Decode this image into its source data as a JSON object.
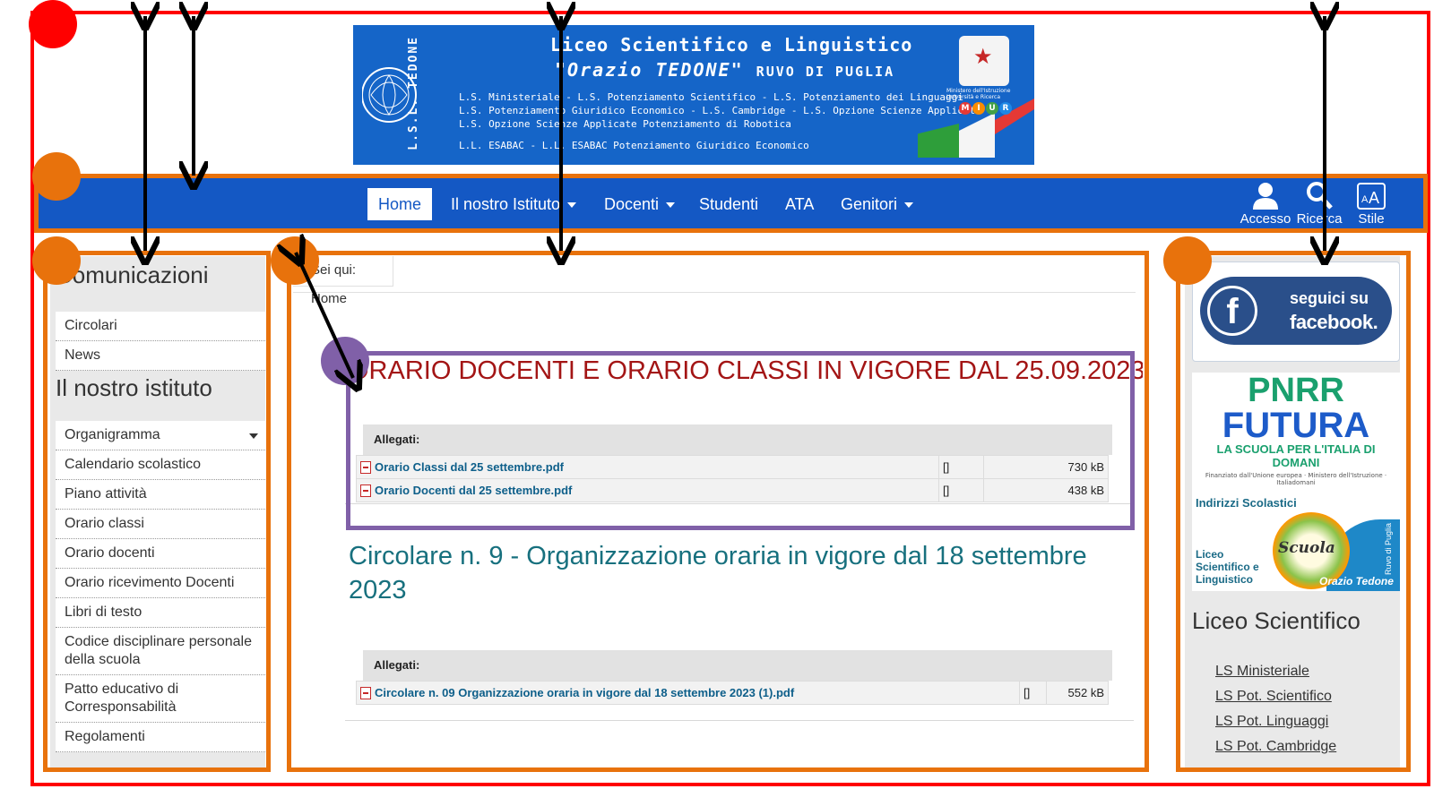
{
  "banner": {
    "seal_text": "L.S.L. TEDONE",
    "line1": "Liceo Scientifico e Linguistico",
    "line2": "\"Orazio TEDONE\"",
    "line2_tail": "RUVO DI PUGLIA",
    "small_lines": [
      "L.S. Ministeriale - L.S. Potenziamento Scientifico - L.S. Potenziamento dei Linguaggi",
      "L.S. Potenziamento Giuridico Economico - L.S. Cambridge - L.S. Opzione Scienze Applicate",
      "L.S. Opzione Scienze Applicate Potenziamento di Robotica",
      "L.L. ESABAC - L.L. ESABAC Potenziamento Giuridico Economico"
    ],
    "ministry": "Ministero dell'Istruzione Università e Ricerca",
    "miur_letters": [
      "M",
      "I",
      "U",
      "R"
    ],
    "miur_colors": [
      "#e53935",
      "#fb8c00",
      "#43a047",
      "#1e88e5"
    ]
  },
  "nav": {
    "items": [
      {
        "label": "Home",
        "active": true,
        "dropdown": false
      },
      {
        "label": "Il nostro Istituto",
        "active": false,
        "dropdown": true
      },
      {
        "label": "Docenti",
        "active": false,
        "dropdown": true
      },
      {
        "label": "Studenti",
        "active": false,
        "dropdown": false
      },
      {
        "label": "ATA",
        "active": false,
        "dropdown": false
      },
      {
        "label": "Genitori",
        "active": false,
        "dropdown": true
      }
    ],
    "utilities": [
      {
        "label": "Accesso",
        "icon": "user-icon"
      },
      {
        "label": "Ricerca",
        "icon": "search-icon"
      },
      {
        "label": "Stile",
        "icon": "text-size-icon"
      }
    ]
  },
  "left_sidebar": {
    "section1_title": "Comunicazioni",
    "section1_items": [
      "Circolari",
      "News"
    ],
    "section2_title": "Il nostro istituto",
    "section2_items": [
      "Organigramma",
      "Calendario scolastico",
      "Piano attività",
      "Orario classi",
      "Orario docenti",
      "Orario ricevimento Docenti",
      "Libri di testo",
      "Codice disciplinare personale della scuola",
      "Patto educativo di Corresponsabilità",
      "Regolamenti"
    ]
  },
  "main": {
    "breadcrumb": "Sei qui:  Home",
    "article1": {
      "title": "ORARIO DOCENTI E ORARIO CLASSI IN VIGORE DAL 25.09.2023",
      "attachments_label": "Allegati:",
      "files": [
        {
          "name": "Orario Classi dal 25 settembre.pdf",
          "hits": "[]",
          "size": "730 kB"
        },
        {
          "name": "Orario Docenti dal 25 settembre.pdf",
          "hits": "[]",
          "size": "438 kB"
        }
      ]
    },
    "article2": {
      "title": "Circolare n. 9 - Organizzazione oraria in vigore dal 18 settembre 2023",
      "attachments_label": "Allegati:",
      "files": [
        {
          "name": "Circolare n. 09 Organizzazione oraria in vigore dal 18 settembre 2023 (1).pdf",
          "hits": "[]",
          "size": "552 kB"
        }
      ]
    }
  },
  "right_sidebar": {
    "facebook_line1": "seguici su",
    "facebook_line2": "facebook.",
    "pnrr_line1": "PNRR",
    "pnrr_line2": "FUTURA",
    "pnrr_line3": "LA SCUOLA PER L'ITALIA DI DOMANI",
    "pnrr_footer": "Finanziato dall'Unione europea · Ministero dell'Istruzione · Italiadomani",
    "indirizzi_title": "Indirizzi Scolastici",
    "indirizzi_sub": "Liceo Scientifico e Linguistico",
    "indirizzi_scuola": "Scuola",
    "indirizzi_tedone": "Orazio Tedone",
    "indirizzi_ruvo": "Ruvo di Puglia",
    "section_title": "Liceo Scientifico",
    "links": [
      "LS Ministeriale",
      "LS Pot. Scientifico",
      "LS Pot. Linguaggi",
      "LS Pot. Cambridge"
    ]
  },
  "annotation_colors": {
    "page": "#ff0000",
    "region": "#e8720c",
    "content": "#8060a8",
    "arrow": "#000000"
  }
}
